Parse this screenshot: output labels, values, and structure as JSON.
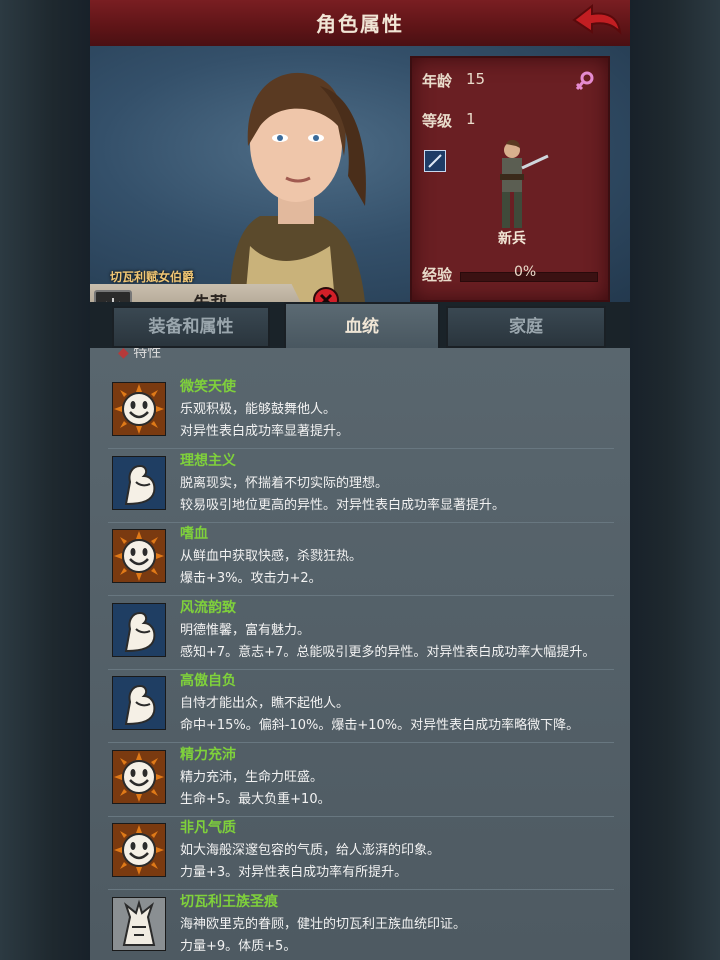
{
  "header": {
    "title": "角色属性"
  },
  "character": {
    "noble_title": "切瓦利赋女伯爵",
    "name": "朱莉",
    "moon": "月",
    "age_label": "年龄",
    "age": "15",
    "level_label": "等级",
    "level": "1",
    "unit_name": "新兵",
    "exp_label": "经验",
    "exp_percent": "0%",
    "exp_fraction": 0.0
  },
  "tabs": [
    {
      "label": "装备和属性"
    },
    {
      "label": "血统"
    },
    {
      "label": "家庭"
    }
  ],
  "section_label": "特性",
  "traits": [
    {
      "name": "微笑天使",
      "icon": "smile-face-icon",
      "lines": [
        "乐观积极，能够鼓舞他人。",
        "对异性表白成功率显著提升。"
      ]
    },
    {
      "name": "理想主义",
      "icon": "flexed-arm-icon",
      "lines": [
        "脱离现实，怀揣着不切实际的理想。",
        "较易吸引地位更高的异性。对异性表白成功率显著提升。"
      ]
    },
    {
      "name": "嗜血",
      "icon": "smile-face-icon",
      "lines": [
        "从鲜血中获取快感，杀戮狂热。",
        "爆击+3%。攻击力+2。"
      ]
    },
    {
      "name": "风流韵致",
      "icon": "flexed-arm-icon",
      "lines": [
        "明德惟馨，富有魅力。",
        "感知+7。意志+7。总能吸引更多的异性。对异性表白成功率大幅提升。"
      ]
    },
    {
      "name": "高傲自负",
      "icon": "flexed-arm-icon",
      "lines": [
        "自恃才能出众，瞧不起他人。",
        "命中+15%。偏斜-10%。爆击+10%。对异性表白成功率略微下降。"
      ]
    },
    {
      "name": "精力充沛",
      "icon": "smile-face-icon",
      "lines": [
        "精力充沛，生命力旺盛。",
        "生命+5。最大负重+10。"
      ]
    },
    {
      "name": "非凡气质",
      "icon": "smile-face-icon",
      "lines": [
        "如大海般深邃包容的气质，给人澎湃的印象。",
        "力量+3。对异性表白成功率有所提升。"
      ]
    },
    {
      "name": "切瓦利王族圣痕",
      "icon": "royal-mark-icon",
      "lines": [
        "海神欧里克的眷顾，健壮的切瓦利王族血统印证。",
        "力量+9。体质+5。"
      ]
    }
  ]
}
